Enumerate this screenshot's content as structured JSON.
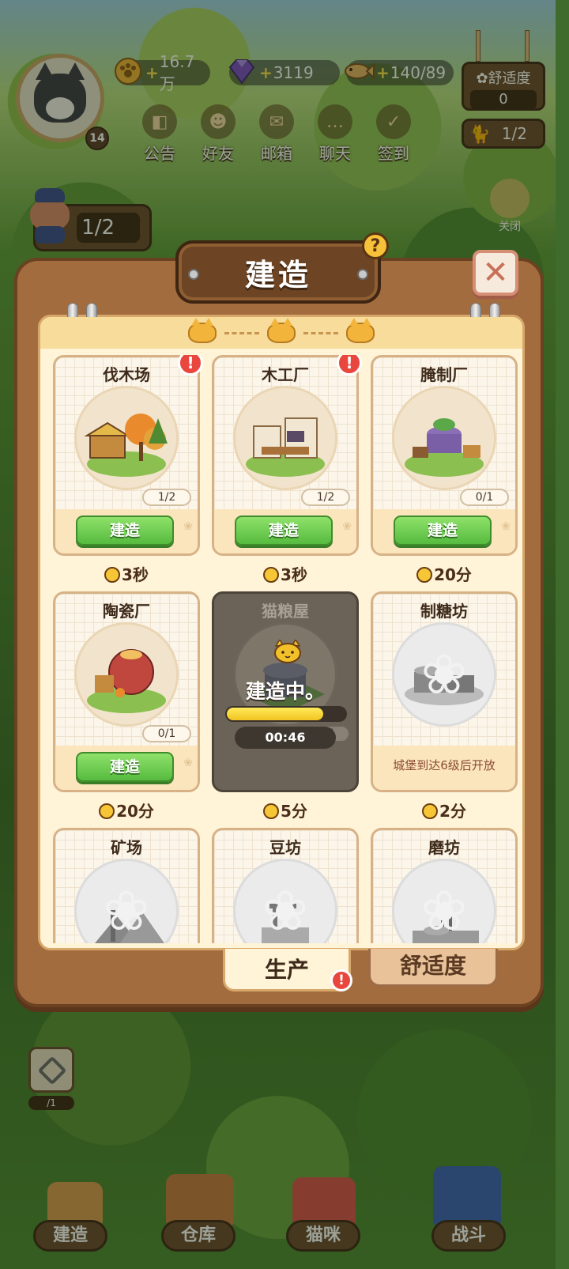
{
  "hud": {
    "player_level": "14",
    "resources": {
      "paw_coins": "16.7万",
      "gems": "3119",
      "fish": "140/89"
    },
    "comfort": {
      "label": "舒适度",
      "value": "0"
    },
    "workers": "1/2",
    "menu": [
      {
        "label": "公告",
        "icon": "announcement-icon"
      },
      {
        "label": "好友",
        "icon": "friends-icon"
      },
      {
        "label": "邮箱",
        "icon": "mailbox-icon"
      },
      {
        "label": "聊天",
        "icon": "chat-icon"
      },
      {
        "label": "签到",
        "icon": "check-in-icon"
      }
    ],
    "guard_counter": "1/2",
    "close_hint": "关闭"
  },
  "dialog": {
    "title": "建造",
    "help": "?",
    "close": "✕",
    "build_label": "建造",
    "buildings": [
      {
        "name": "伐木场",
        "count": "1/2",
        "action": "建造",
        "time": "3秒",
        "alert": "!"
      },
      {
        "name": "木工厂",
        "count": "1/2",
        "action": "建造",
        "time": "3秒",
        "alert": "!"
      },
      {
        "name": "腌制厂",
        "count": "0/1",
        "action": "建造",
        "time": "20分"
      },
      {
        "name": "陶瓷厂",
        "count": "0/1",
        "action": "建造",
        "time": "20分"
      },
      {
        "name": "猫粮屋",
        "count": "2/4",
        "status": "建造中。",
        "timer": "00:46",
        "progress": 0.82,
        "time": "5分"
      },
      {
        "name": "制糖坊",
        "lock_message": "城堡到达6级后开放",
        "time": "2分"
      },
      {
        "name": "矿场"
      },
      {
        "name": "豆坊"
      },
      {
        "name": "磨坊"
      }
    ],
    "tabs": [
      {
        "label": "生产",
        "alert": "!"
      },
      {
        "label": "舒适度"
      }
    ]
  },
  "bottom_nav": [
    {
      "label": "建造"
    },
    {
      "label": "仓库"
    },
    {
      "label": "猫咪"
    },
    {
      "label": "战斗"
    }
  ],
  "side_tool_count": "/1",
  "colors": {
    "build_button": "#56bb3f",
    "alert": "#e9463d",
    "dialog_wood": "#a36c3f",
    "panel_cream": "#fff3d8"
  }
}
